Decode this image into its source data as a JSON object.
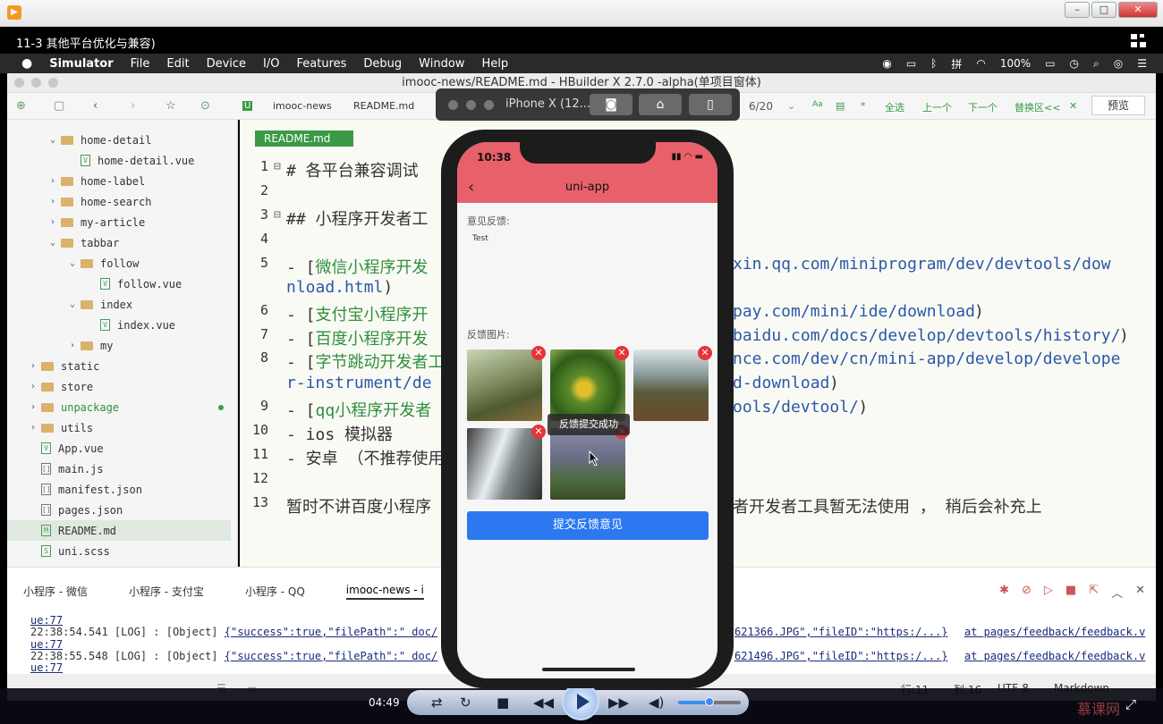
{
  "player": {
    "video_title": "11-3 其他平台优化与兼容)",
    "time": "04:49"
  },
  "mac_menu": [
    "Simulator",
    "File",
    "Edit",
    "Device",
    "I/O",
    "Features",
    "Debug",
    "Window",
    "Help"
  ],
  "mac_status": {
    "battery": "100%"
  },
  "hbuilder": {
    "window_title": "imooc-news/README.md - HBuilder X 2.7.0 -alpha(单项目窗体)",
    "breadcrumb": [
      "imooc-news",
      "README.md"
    ],
    "search_count": "6/20",
    "search_tools": [
      "Aa",
      "全选",
      "上一个",
      "下一个",
      "替换区<<"
    ],
    "preview": "预览",
    "editor_tab": "README.md"
  },
  "sidebar": {
    "items": [
      {
        "label": "home-detail",
        "kind": "folder",
        "open": true,
        "indent": 1
      },
      {
        "label": "home-detail.vue",
        "kind": "vue",
        "indent": 2
      },
      {
        "label": "home-label",
        "kind": "folder",
        "open": false,
        "indent": 1
      },
      {
        "label": "home-search",
        "kind": "folder",
        "open": false,
        "indent": 1
      },
      {
        "label": "my-article",
        "kind": "folder",
        "open": false,
        "indent": 1
      },
      {
        "label": "tabbar",
        "kind": "folder",
        "open": true,
        "indent": 1
      },
      {
        "label": "follow",
        "kind": "folder",
        "open": true,
        "indent": 2
      },
      {
        "label": "follow.vue",
        "kind": "vue",
        "indent": 3
      },
      {
        "label": "index",
        "kind": "folder",
        "open": true,
        "indent": 2
      },
      {
        "label": "index.vue",
        "kind": "vue",
        "indent": 3
      },
      {
        "label": "my",
        "kind": "folder",
        "open": false,
        "indent": 2
      },
      {
        "label": "static",
        "kind": "folder",
        "open": false,
        "indent": 0
      },
      {
        "label": "store",
        "kind": "folder",
        "open": false,
        "indent": 0
      },
      {
        "label": "unpackage",
        "kind": "folder",
        "open": false,
        "indent": 0
      },
      {
        "label": "utils",
        "kind": "folder",
        "open": false,
        "indent": 0
      },
      {
        "label": "App.vue",
        "kind": "vue",
        "indent": 0
      },
      {
        "label": "main.js",
        "kind": "js",
        "indent": 0
      },
      {
        "label": "manifest.json",
        "kind": "json",
        "indent": 0
      },
      {
        "label": "pages.json",
        "kind": "json",
        "indent": 0
      },
      {
        "label": "README.md",
        "kind": "md",
        "indent": 0
      },
      {
        "label": "uni.scss",
        "kind": "scss",
        "indent": 0
      }
    ]
  },
  "editor_lines": [
    {
      "n": "1",
      "t": "# 各平台兼容调试"
    },
    {
      "n": "2",
      "t": ""
    },
    {
      "n": "3",
      "t": "## 小程序开发者工"
    },
    {
      "n": "4",
      "t": ""
    },
    {
      "n": "5",
      "a": "- [",
      "g": "微信小程序开发",
      "b": "xin.qq.com/miniprogram/dev/devtools/dow"
    },
    {
      "n": "",
      "b": "nload.html",
      "a": ")"
    },
    {
      "n": "6",
      "a": "- [",
      "g": "支付宝小程序开",
      "b": "pay.com/mini/ide/download",
      "z": ")"
    },
    {
      "n": "7",
      "a": "- [",
      "g": "百度小程序开发",
      "b": "baidu.com/docs/develop/devtools/history/",
      "z": ")"
    },
    {
      "n": "8",
      "a": "- [",
      "g": "字节跳动开发者工",
      "b": "nce.com/dev/cn/mini-app/develop/develope"
    },
    {
      "n": "",
      "b": "r-instrument/de",
      "c": "d-download",
      "z": ")"
    },
    {
      "n": "9",
      "a": "- [",
      "g": "qq小程序开发者",
      "b": "ools/devtool/",
      "z": ")"
    },
    {
      "n": "10",
      "t": "- ios 模拟器"
    },
    {
      "n": "11",
      "t": "- 安卓 （不推荐使用"
    },
    {
      "n": "12",
      "t": ""
    },
    {
      "n": "13",
      "t": "暂时不讲百度小程序",
      "t2": "者开发者工具暂无法使用 ， 稍后会补充上"
    }
  ],
  "console": {
    "tabs": [
      "小程序 - 微信",
      "小程序 - 支付宝",
      "小程序 - QQ",
      "imooc-news - i"
    ],
    "logs": [
      {
        "a": "ue:77"
      },
      {
        "a": "22:38:54.541 [LOG] : [Object] ",
        "u": "{\"success\":true,\"filePath\":\" doc/",
        "u2": "621366.JPG\",\"fileID\":\"https:/...}",
        "src": "at pages/feedback/feedback.v"
      },
      {
        "a": "ue:77"
      },
      {
        "a": "22:38:55.548 [LOG] : [Object] ",
        "u": "{\"success\":true,\"filePath\":\" doc/",
        "u2": "621496.JPG\",\"fileID\":\"https:/...}",
        "src": "at pages/feedback/feedback.v"
      },
      {
        "a": "ue:77"
      }
    ]
  },
  "statusbar": {
    "row": "行:11",
    "col": "列:16",
    "encoding": "UTF-8",
    "lang": "Markdown"
  },
  "simulator": {
    "device": "iPhone X (12...",
    "time": "10:38",
    "nav_title": "uni-app",
    "feedback_label": "意见反馈:",
    "feedback_text": "Test",
    "images_label": "反馈图片:",
    "toast": "反馈提交成功",
    "submit": "提交反馈意见"
  },
  "brand": "慕课网"
}
